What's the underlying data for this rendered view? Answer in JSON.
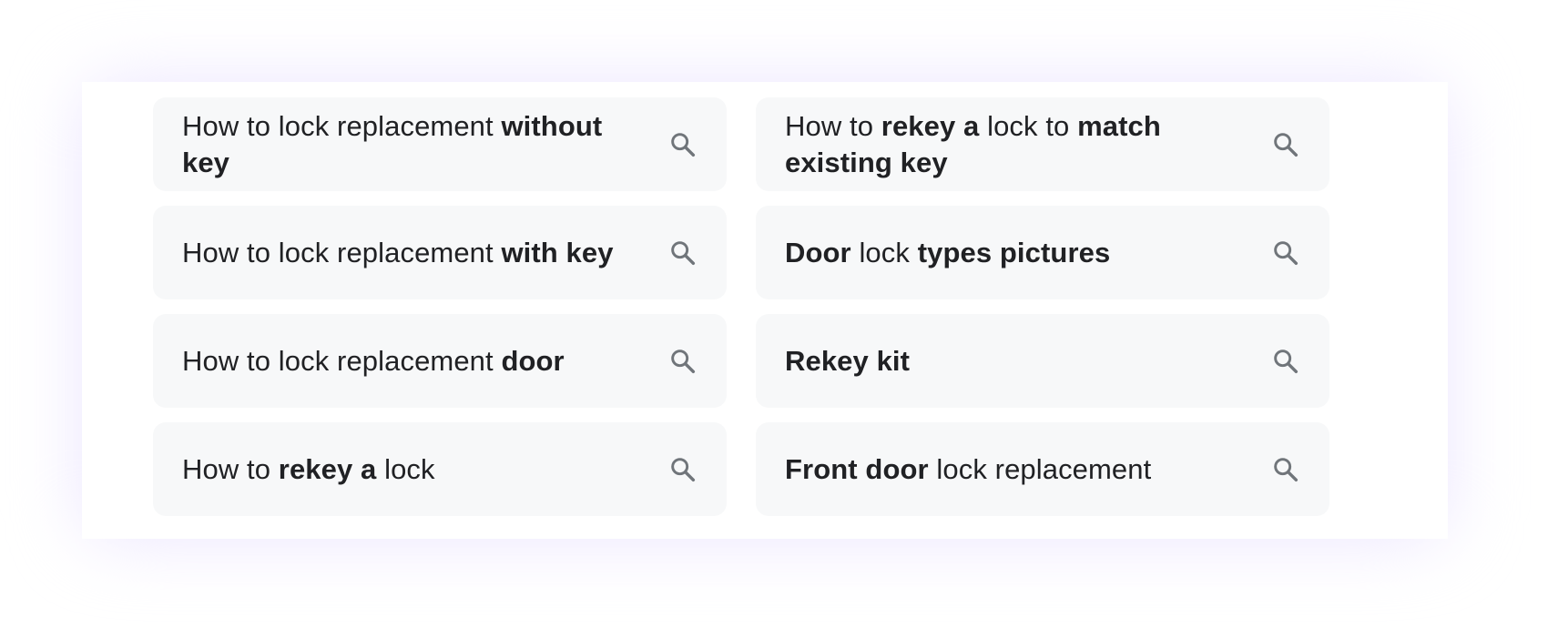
{
  "suggestions": [
    {
      "segments": [
        {
          "text": "How to lock replacement ",
          "bold": false
        },
        {
          "text": "without key",
          "bold": true
        }
      ],
      "icon": "search-icon"
    },
    {
      "segments": [
        {
          "text": "How to ",
          "bold": false
        },
        {
          "text": "rekey a",
          "bold": true
        },
        {
          "text": " lock to ",
          "bold": false
        },
        {
          "text": "match existing key",
          "bold": true
        }
      ],
      "icon": "search-icon"
    },
    {
      "segments": [
        {
          "text": "How to lock replacement ",
          "bold": false
        },
        {
          "text": "with key",
          "bold": true
        }
      ],
      "icon": "search-icon"
    },
    {
      "segments": [
        {
          "text": "Door",
          "bold": true
        },
        {
          "text": " lock ",
          "bold": false
        },
        {
          "text": "types pictures",
          "bold": true
        }
      ],
      "icon": "search-icon"
    },
    {
      "segments": [
        {
          "text": "How to lock replacement ",
          "bold": false
        },
        {
          "text": "door",
          "bold": true
        }
      ],
      "icon": "search-icon"
    },
    {
      "segments": [
        {
          "text": "Rekey kit",
          "bold": true
        }
      ],
      "icon": "search-icon"
    },
    {
      "segments": [
        {
          "text": "How to ",
          "bold": false
        },
        {
          "text": "rekey a",
          "bold": true
        },
        {
          "text": " lock",
          "bold": false
        }
      ],
      "icon": "search-icon"
    },
    {
      "segments": [
        {
          "text": "Front door",
          "bold": true
        },
        {
          "text": " lock replacement",
          "bold": false
        }
      ],
      "icon": "search-icon"
    }
  ],
  "colors": {
    "chip_background": "#f7f8f9",
    "text": "#202124",
    "icon": "#70757a",
    "glow": "#ece6ff"
  }
}
